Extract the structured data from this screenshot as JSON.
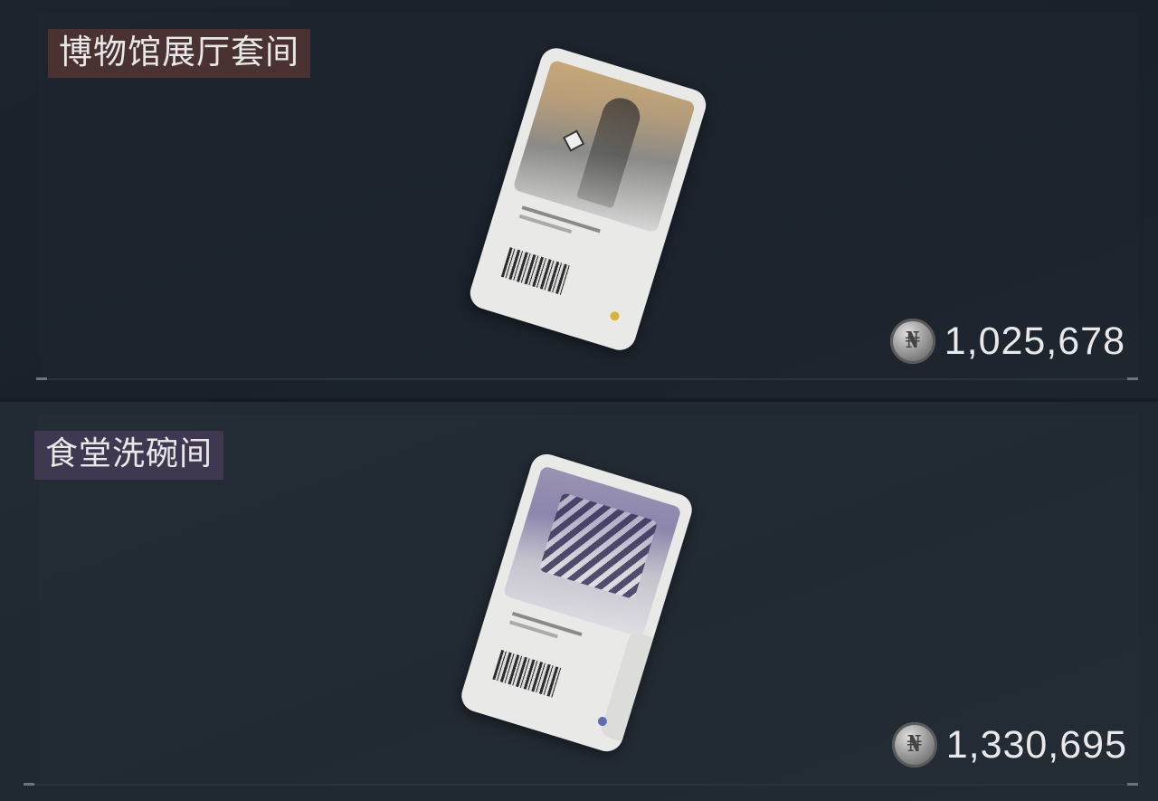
{
  "items": [
    {
      "name": "博物馆展厅套间",
      "price": "1,025,678",
      "icon": "access-card-icon",
      "label_color": "#4a3233"
    },
    {
      "name": "食堂洗碗间",
      "price": "1,330,695",
      "icon": "access-card-icon",
      "label_color": "#3f3850"
    }
  ],
  "currency_icon": "silver-coin-icon"
}
